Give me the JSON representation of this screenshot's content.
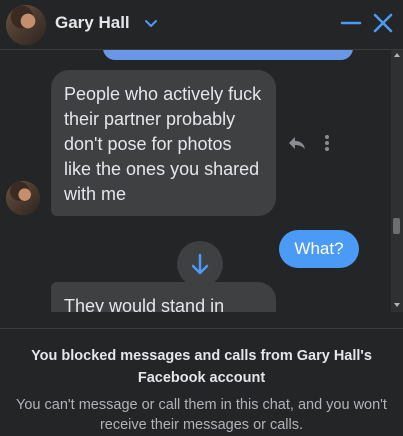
{
  "header": {
    "contact_name": "Gary Hall"
  },
  "messages": [
    {
      "direction": "incoming",
      "text": "People who actively fuck their partner probably don't pose for photos like the ones you shared with me"
    },
    {
      "direction": "outgoing",
      "text": "What?"
    },
    {
      "direction": "incoming",
      "text": "They would stand in"
    }
  ],
  "footer": {
    "title": "You blocked messages and calls from Gary Hall's Facebook account",
    "subtitle": "You can't message or call them in this chat, and you won't receive their messages or calls."
  },
  "icons": {
    "contact_avatar": "profile-photo",
    "header_chevron": "chevron-down-icon",
    "minimize": "minimize-icon",
    "close": "close-icon",
    "reply": "reply-icon",
    "more": "more-vertical-icon",
    "jump": "arrow-down-icon"
  },
  "colors": {
    "background": "#242526",
    "incoming_bubble": "#3e4042",
    "outgoing_bubble": "#4b9bf6",
    "accent": "#4b9bf6"
  }
}
